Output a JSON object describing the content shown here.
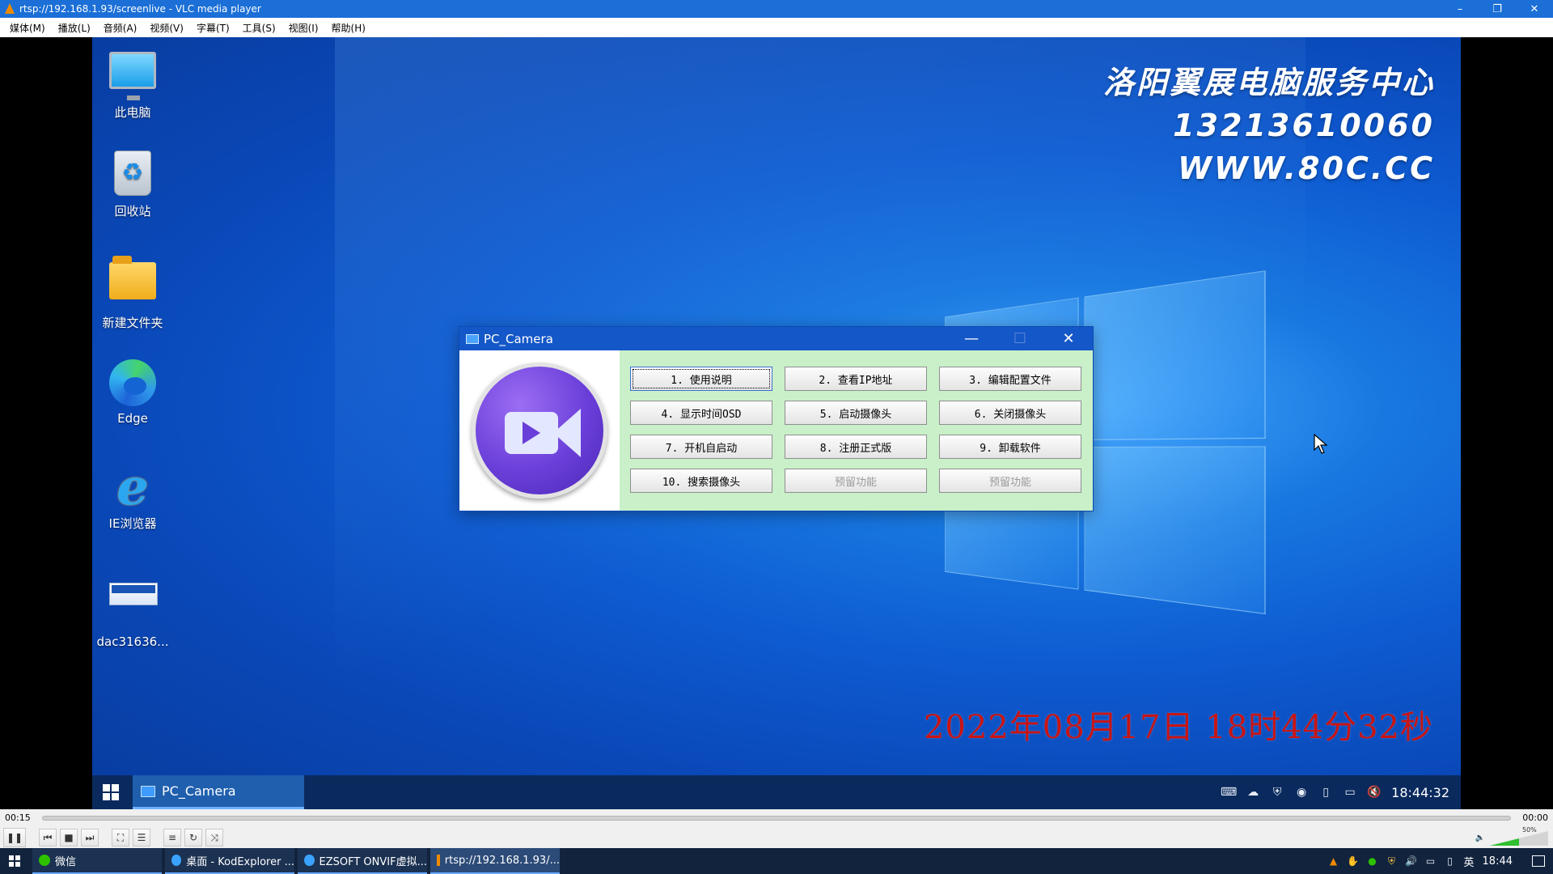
{
  "vlc": {
    "title": "rtsp://192.168.1.93/screenlive - VLC media player",
    "window_controls": {
      "minimize": "–",
      "restore": "❐",
      "close": "✕"
    },
    "menu": [
      "媒体(M)",
      "播放(L)",
      "音频(A)",
      "视频(V)",
      "字幕(T)",
      "工具(S)",
      "视图(I)",
      "帮助(H)"
    ],
    "elapsed": "00:15",
    "remaining": "00:00",
    "volume_label": "50%"
  },
  "desktop": {
    "icons": [
      {
        "label": "此电脑",
        "icon": "this-pc-icon"
      },
      {
        "label": "回收站",
        "icon": "recycle-bin-icon"
      },
      {
        "label": "新建文件夹",
        "icon": "folder-icon"
      },
      {
        "label": "Edge",
        "icon": "edge-icon"
      },
      {
        "label": "IE浏览器",
        "icon": "ie-icon"
      },
      {
        "label": "dac31636...",
        "icon": "image-file-icon"
      }
    ],
    "overlay": {
      "line1": "洛阳翼展电脑服务中心",
      "line2": "13213610060",
      "line3": "WWW.80C.CC"
    },
    "timestamp": "2022年08月17日 18时44分32秒"
  },
  "pc_camera": {
    "title": "PC_Camera",
    "controls": {
      "minimize": "—",
      "maximize": "☐",
      "close": "✕"
    },
    "buttons": [
      {
        "label": "1. 使用说明",
        "state": "focused"
      },
      {
        "label": "2. 查看IP地址",
        "state": "normal"
      },
      {
        "label": "3. 编辑配置文件",
        "state": "normal"
      },
      {
        "label": "4. 显示时间OSD",
        "state": "normal"
      },
      {
        "label": "5. 启动摄像头",
        "state": "normal"
      },
      {
        "label": "6. 关闭摄像头",
        "state": "normal"
      },
      {
        "label": "7. 开机自启动",
        "state": "normal"
      },
      {
        "label": "8. 注册正式版",
        "state": "normal"
      },
      {
        "label": "9. 卸载软件",
        "state": "normal"
      },
      {
        "label": "10. 搜索摄像头",
        "state": "normal"
      },
      {
        "label": "预留功能",
        "state": "disabled"
      },
      {
        "label": "预留功能",
        "state": "disabled"
      }
    ]
  },
  "remote_taskbar": {
    "task_label": "PC_Camera",
    "clock": "18:44:32"
  },
  "host_taskbar": {
    "tasks": [
      {
        "label": "微信",
        "color": "#2dc100"
      },
      {
        "label": "桌面 - KodExplorer ...",
        "color": "#3aa3ff"
      },
      {
        "label": "EZSOFT ONVIF虚拟...",
        "color": "#3aa3ff"
      },
      {
        "label": "rtsp://192.168.1.93/...",
        "color": "#f08a00"
      }
    ],
    "ime": "英",
    "clock": "18:44"
  }
}
